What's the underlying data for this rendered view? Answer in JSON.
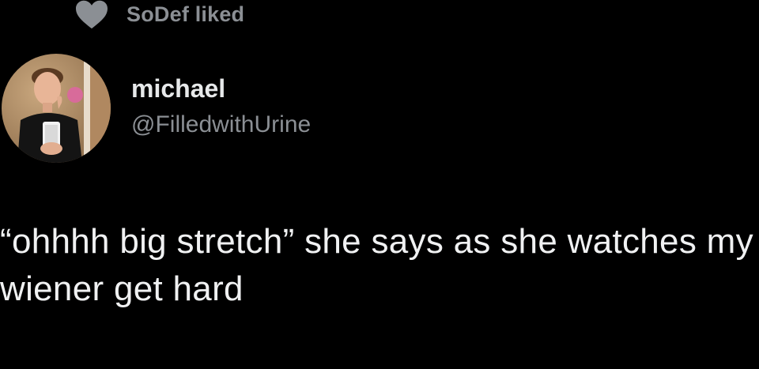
{
  "social_context": {
    "icon": "heart-icon",
    "text": "SoDef liked"
  },
  "author": {
    "avatar": "profile-avatar",
    "display_name": "michael",
    "handle": "@FilledwithUrine"
  },
  "tweet": {
    "text": "“ohhhh big stretch” she says as she watches my wiener get hard"
  },
  "colors": {
    "background": "#000000",
    "primary_text": "#e7e9ea",
    "secondary_text": "#8b8f94"
  }
}
